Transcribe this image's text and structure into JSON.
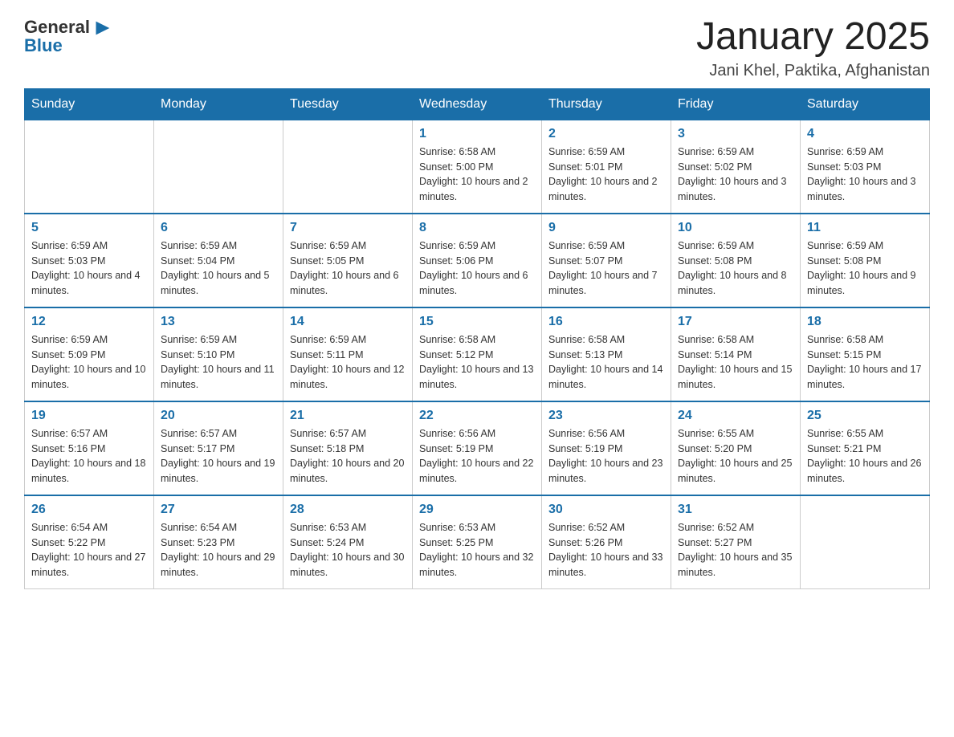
{
  "header": {
    "logo_general": "General",
    "logo_blue": "Blue",
    "month_title": "January 2025",
    "location": "Jani Khel, Paktika, Afghanistan"
  },
  "weekdays": [
    "Sunday",
    "Monday",
    "Tuesday",
    "Wednesday",
    "Thursday",
    "Friday",
    "Saturday"
  ],
  "weeks": [
    [
      {
        "day": "",
        "info": ""
      },
      {
        "day": "",
        "info": ""
      },
      {
        "day": "",
        "info": ""
      },
      {
        "day": "1",
        "info": "Sunrise: 6:58 AM\nSunset: 5:00 PM\nDaylight: 10 hours and 2 minutes."
      },
      {
        "day": "2",
        "info": "Sunrise: 6:59 AM\nSunset: 5:01 PM\nDaylight: 10 hours and 2 minutes."
      },
      {
        "day": "3",
        "info": "Sunrise: 6:59 AM\nSunset: 5:02 PM\nDaylight: 10 hours and 3 minutes."
      },
      {
        "day": "4",
        "info": "Sunrise: 6:59 AM\nSunset: 5:03 PM\nDaylight: 10 hours and 3 minutes."
      }
    ],
    [
      {
        "day": "5",
        "info": "Sunrise: 6:59 AM\nSunset: 5:03 PM\nDaylight: 10 hours and 4 minutes."
      },
      {
        "day": "6",
        "info": "Sunrise: 6:59 AM\nSunset: 5:04 PM\nDaylight: 10 hours and 5 minutes."
      },
      {
        "day": "7",
        "info": "Sunrise: 6:59 AM\nSunset: 5:05 PM\nDaylight: 10 hours and 6 minutes."
      },
      {
        "day": "8",
        "info": "Sunrise: 6:59 AM\nSunset: 5:06 PM\nDaylight: 10 hours and 6 minutes."
      },
      {
        "day": "9",
        "info": "Sunrise: 6:59 AM\nSunset: 5:07 PM\nDaylight: 10 hours and 7 minutes."
      },
      {
        "day": "10",
        "info": "Sunrise: 6:59 AM\nSunset: 5:08 PM\nDaylight: 10 hours and 8 minutes."
      },
      {
        "day": "11",
        "info": "Sunrise: 6:59 AM\nSunset: 5:08 PM\nDaylight: 10 hours and 9 minutes."
      }
    ],
    [
      {
        "day": "12",
        "info": "Sunrise: 6:59 AM\nSunset: 5:09 PM\nDaylight: 10 hours and 10 minutes."
      },
      {
        "day": "13",
        "info": "Sunrise: 6:59 AM\nSunset: 5:10 PM\nDaylight: 10 hours and 11 minutes."
      },
      {
        "day": "14",
        "info": "Sunrise: 6:59 AM\nSunset: 5:11 PM\nDaylight: 10 hours and 12 minutes."
      },
      {
        "day": "15",
        "info": "Sunrise: 6:58 AM\nSunset: 5:12 PM\nDaylight: 10 hours and 13 minutes."
      },
      {
        "day": "16",
        "info": "Sunrise: 6:58 AM\nSunset: 5:13 PM\nDaylight: 10 hours and 14 minutes."
      },
      {
        "day": "17",
        "info": "Sunrise: 6:58 AM\nSunset: 5:14 PM\nDaylight: 10 hours and 15 minutes."
      },
      {
        "day": "18",
        "info": "Sunrise: 6:58 AM\nSunset: 5:15 PM\nDaylight: 10 hours and 17 minutes."
      }
    ],
    [
      {
        "day": "19",
        "info": "Sunrise: 6:57 AM\nSunset: 5:16 PM\nDaylight: 10 hours and 18 minutes."
      },
      {
        "day": "20",
        "info": "Sunrise: 6:57 AM\nSunset: 5:17 PM\nDaylight: 10 hours and 19 minutes."
      },
      {
        "day": "21",
        "info": "Sunrise: 6:57 AM\nSunset: 5:18 PM\nDaylight: 10 hours and 20 minutes."
      },
      {
        "day": "22",
        "info": "Sunrise: 6:56 AM\nSunset: 5:19 PM\nDaylight: 10 hours and 22 minutes."
      },
      {
        "day": "23",
        "info": "Sunrise: 6:56 AM\nSunset: 5:19 PM\nDaylight: 10 hours and 23 minutes."
      },
      {
        "day": "24",
        "info": "Sunrise: 6:55 AM\nSunset: 5:20 PM\nDaylight: 10 hours and 25 minutes."
      },
      {
        "day": "25",
        "info": "Sunrise: 6:55 AM\nSunset: 5:21 PM\nDaylight: 10 hours and 26 minutes."
      }
    ],
    [
      {
        "day": "26",
        "info": "Sunrise: 6:54 AM\nSunset: 5:22 PM\nDaylight: 10 hours and 27 minutes."
      },
      {
        "day": "27",
        "info": "Sunrise: 6:54 AM\nSunset: 5:23 PM\nDaylight: 10 hours and 29 minutes."
      },
      {
        "day": "28",
        "info": "Sunrise: 6:53 AM\nSunset: 5:24 PM\nDaylight: 10 hours and 30 minutes."
      },
      {
        "day": "29",
        "info": "Sunrise: 6:53 AM\nSunset: 5:25 PM\nDaylight: 10 hours and 32 minutes."
      },
      {
        "day": "30",
        "info": "Sunrise: 6:52 AM\nSunset: 5:26 PM\nDaylight: 10 hours and 33 minutes."
      },
      {
        "day": "31",
        "info": "Sunrise: 6:52 AM\nSunset: 5:27 PM\nDaylight: 10 hours and 35 minutes."
      },
      {
        "day": "",
        "info": ""
      }
    ]
  ]
}
